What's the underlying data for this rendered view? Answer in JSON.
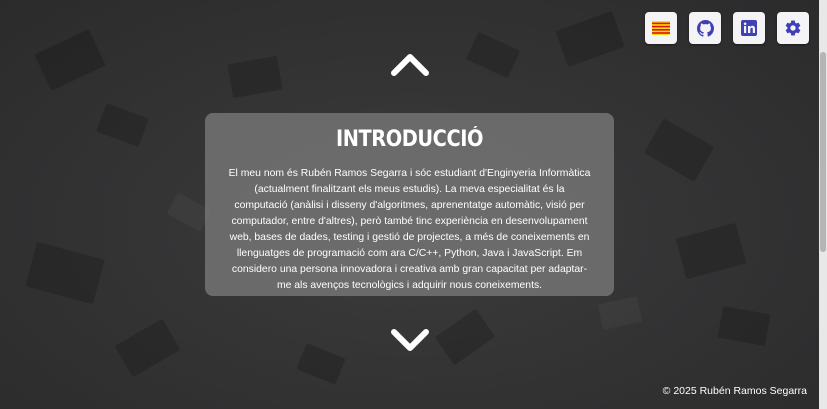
{
  "header": {
    "buttons": [
      {
        "icon": "catalan-flag-icon"
      },
      {
        "icon": "github-icon"
      },
      {
        "icon": "linkedin-icon"
      },
      {
        "icon": "gear-icon"
      }
    ]
  },
  "navigation": {
    "up_icon": "chevron-up-icon",
    "down_icon": "chevron-down-icon"
  },
  "intro": {
    "title": "INTRODUCCIÓ",
    "body": "El meu nom és Rubén Ramos Segarra i sóc estudiant d'Enginyeria Informàtica (actualment finalitzant els meus estudis). La meva especialitat és la computació (anàlisi i disseny d'algoritmes, aprenentatge automàtic, visió per computador, entre d'altres), però també tinc experiència en desenvolupament web, bases de dades, testing i gestió de projectes, a més de coneixements en llenguatges de programació com ara C/C++, Python, Java i JavaScript. Em considero una persona innovadora i creativa amb gran capacitat per adaptar-me als avenços tecnològics i adquirir nous coneixements."
  },
  "footer": {
    "copyright": "© 2025 Rubén Ramos Segarra"
  },
  "colors": {
    "background": "#343435",
    "card": "#767676",
    "accent": "#3f3fb8",
    "button_bg": "#f4f4f6"
  }
}
